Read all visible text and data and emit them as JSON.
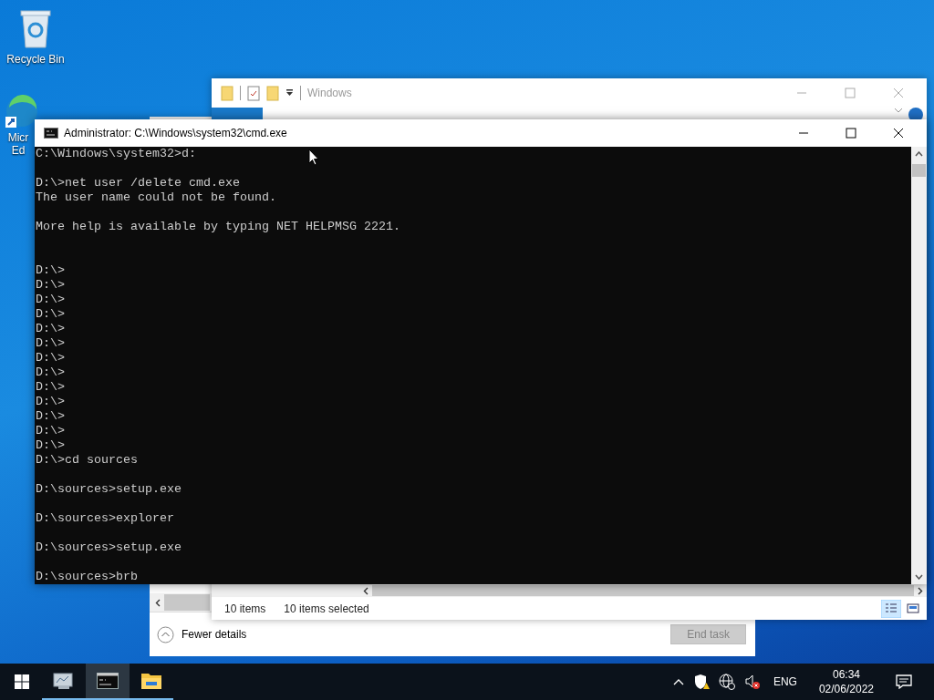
{
  "desktop_icons": [
    {
      "kind": "recycle-bin",
      "label": "Recycle Bin"
    },
    {
      "kind": "browser",
      "label": "Micr Ed"
    }
  ],
  "task_manager": {
    "details_toggle": "Fewer details",
    "end_task": {
      "label": "End task",
      "disabled": true
    }
  },
  "explorer": {
    "title": "Windows",
    "active": false,
    "status_items": "10 items",
    "status_selected": "10 items selected",
    "views": [
      {
        "kind": "details",
        "selected": true
      },
      {
        "kind": "preview",
        "selected": false
      }
    ]
  },
  "cmd": {
    "title": "Administrator: C:\\Windows\\system32\\cmd.exe",
    "output": "C:\\Windows\\system32>d:\n\nD:\\>net user /delete cmd.exe\nThe user name could not be found.\n\nMore help is available by typing NET HELPMSG 2221.\n\n\nD:\\>\nD:\\>\nD:\\>\nD:\\>\nD:\\>\nD:\\>\nD:\\>\nD:\\>\nD:\\>\nD:\\>\nD:\\>\nD:\\>\nD:\\>\nD:\\>cd sources\n\nD:\\sources>setup.exe\n\nD:\\sources>explorer\n\nD:\\sources>setup.exe\n\nD:\\sources>brb"
  },
  "taskbar": {
    "apps": [
      {
        "kind": "server-manager",
        "active": false
      },
      {
        "kind": "console",
        "active": true
      },
      {
        "kind": "folder",
        "active": false
      }
    ],
    "language": "ENG",
    "time": "06:34",
    "date": "02/06/2022"
  }
}
